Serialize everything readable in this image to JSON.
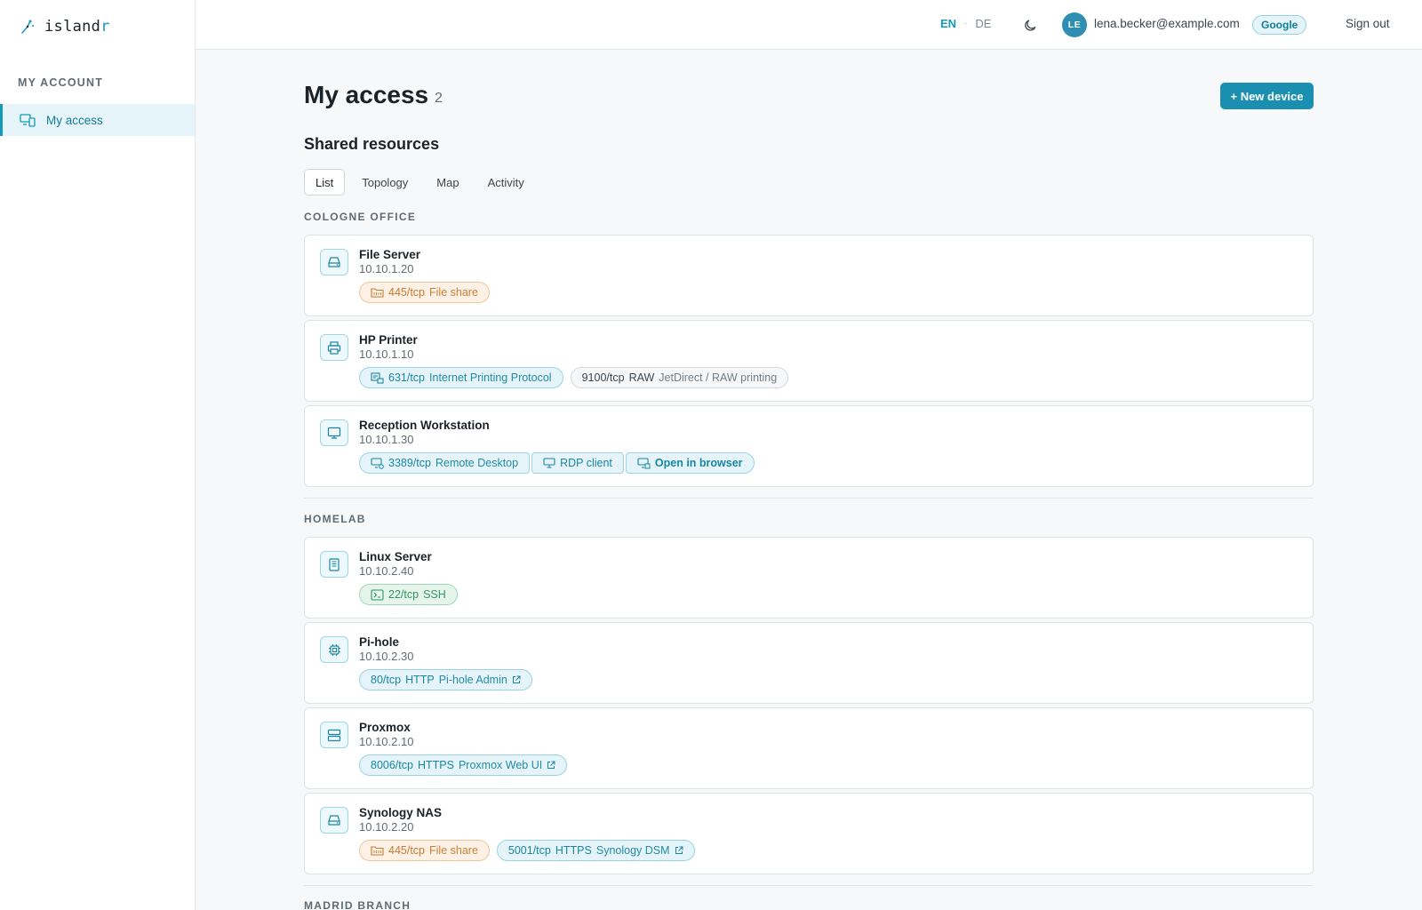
{
  "app": {
    "logo_prefix": "island",
    "logo_accent": "r"
  },
  "sidebar": {
    "heading": "MY ACCOUNT",
    "items": [
      {
        "label": "My access"
      }
    ]
  },
  "header": {
    "lang_en": "EN",
    "lang_sep": "·",
    "lang_de": "DE",
    "avatar_initials": "LE",
    "email": "lena.becker@example.com",
    "provider": "Google",
    "signout": "Sign out"
  },
  "page": {
    "title": "My access",
    "count": "2",
    "new_device": "+ New device",
    "section_title": "Shared resources"
  },
  "tabs": [
    {
      "label": "List"
    },
    {
      "label": "Topology"
    },
    {
      "label": "Map"
    },
    {
      "label": "Activity"
    }
  ],
  "groups": [
    {
      "label": "COLOGNE OFFICE",
      "devices": [
        {
          "name": "File Server",
          "ip": "10.10.1.20",
          "icon": "hard-drive-icon",
          "chips": [
            {
              "style": "orange",
              "icon": "folder-icon",
              "port": "445/tcp",
              "proto": "",
              "sub": "File share"
            }
          ]
        },
        {
          "name": "HP Printer",
          "ip": "10.10.1.10",
          "icon": "printer-icon",
          "chips": [
            {
              "style": "blue",
              "icon": "print-queue-icon",
              "port": "631/tcp",
              "proto": "",
              "sub": "Internet Printing Protocol"
            },
            {
              "style": "gray",
              "icon": "",
              "port": "9100/tcp",
              "proto": "RAW",
              "sub": "JetDirect / RAW printing"
            }
          ]
        },
        {
          "name": "Reception Workstation",
          "ip": "10.10.1.30",
          "icon": "monitor-icon",
          "chips": [
            {
              "style": "blue",
              "icon": "remote-desktop-icon",
              "port": "3389/tcp",
              "proto": "",
              "sub": "Remote Desktop"
            },
            {
              "style": "blue",
              "icon": "monitor-icon",
              "port": "",
              "proto": "",
              "sub": "RDP client"
            },
            {
              "style": "blue",
              "icon": "browser-icon",
              "port": "",
              "proto": "",
              "sub": "Open in browser"
            }
          ]
        }
      ]
    },
    {
      "label": "HOMELAB",
      "devices": [
        {
          "name": "Linux Server",
          "ip": "10.10.2.40",
          "icon": "server-rack-icon",
          "chips": [
            {
              "style": "green",
              "icon": "terminal-icon",
              "port": "22/tcp",
              "proto": "",
              "sub": "SSH"
            }
          ]
        },
        {
          "name": "Pi-hole",
          "ip": "10.10.2.30",
          "icon": "chip-icon",
          "chips": [
            {
              "style": "blue",
              "icon": "",
              "port": "80/tcp",
              "proto": "HTTP",
              "sub": "Pi-hole Admin",
              "external": true
            }
          ]
        },
        {
          "name": "Proxmox",
          "ip": "10.10.2.10",
          "icon": "server-stack-icon",
          "chips": [
            {
              "style": "blue",
              "icon": "",
              "port": "8006/tcp",
              "proto": "HTTPS",
              "sub": "Proxmox Web UI",
              "external": true
            }
          ]
        },
        {
          "name": "Synology NAS",
          "ip": "10.10.2.20",
          "icon": "hard-drive-icon",
          "chips": [
            {
              "style": "orange",
              "icon": "folder-icon",
              "port": "445/tcp",
              "proto": "",
              "sub": "File share"
            },
            {
              "style": "blue",
              "icon": "",
              "port": "5001/tcp",
              "proto": "HTTPS",
              "sub": "Synology DSM",
              "external": true
            }
          ]
        }
      ]
    },
    {
      "label": "MADRID BRANCH",
      "devices": []
    }
  ],
  "colors": {
    "accent": "#1499b8",
    "orange": "#c67a2e",
    "green": "#2e9360"
  }
}
